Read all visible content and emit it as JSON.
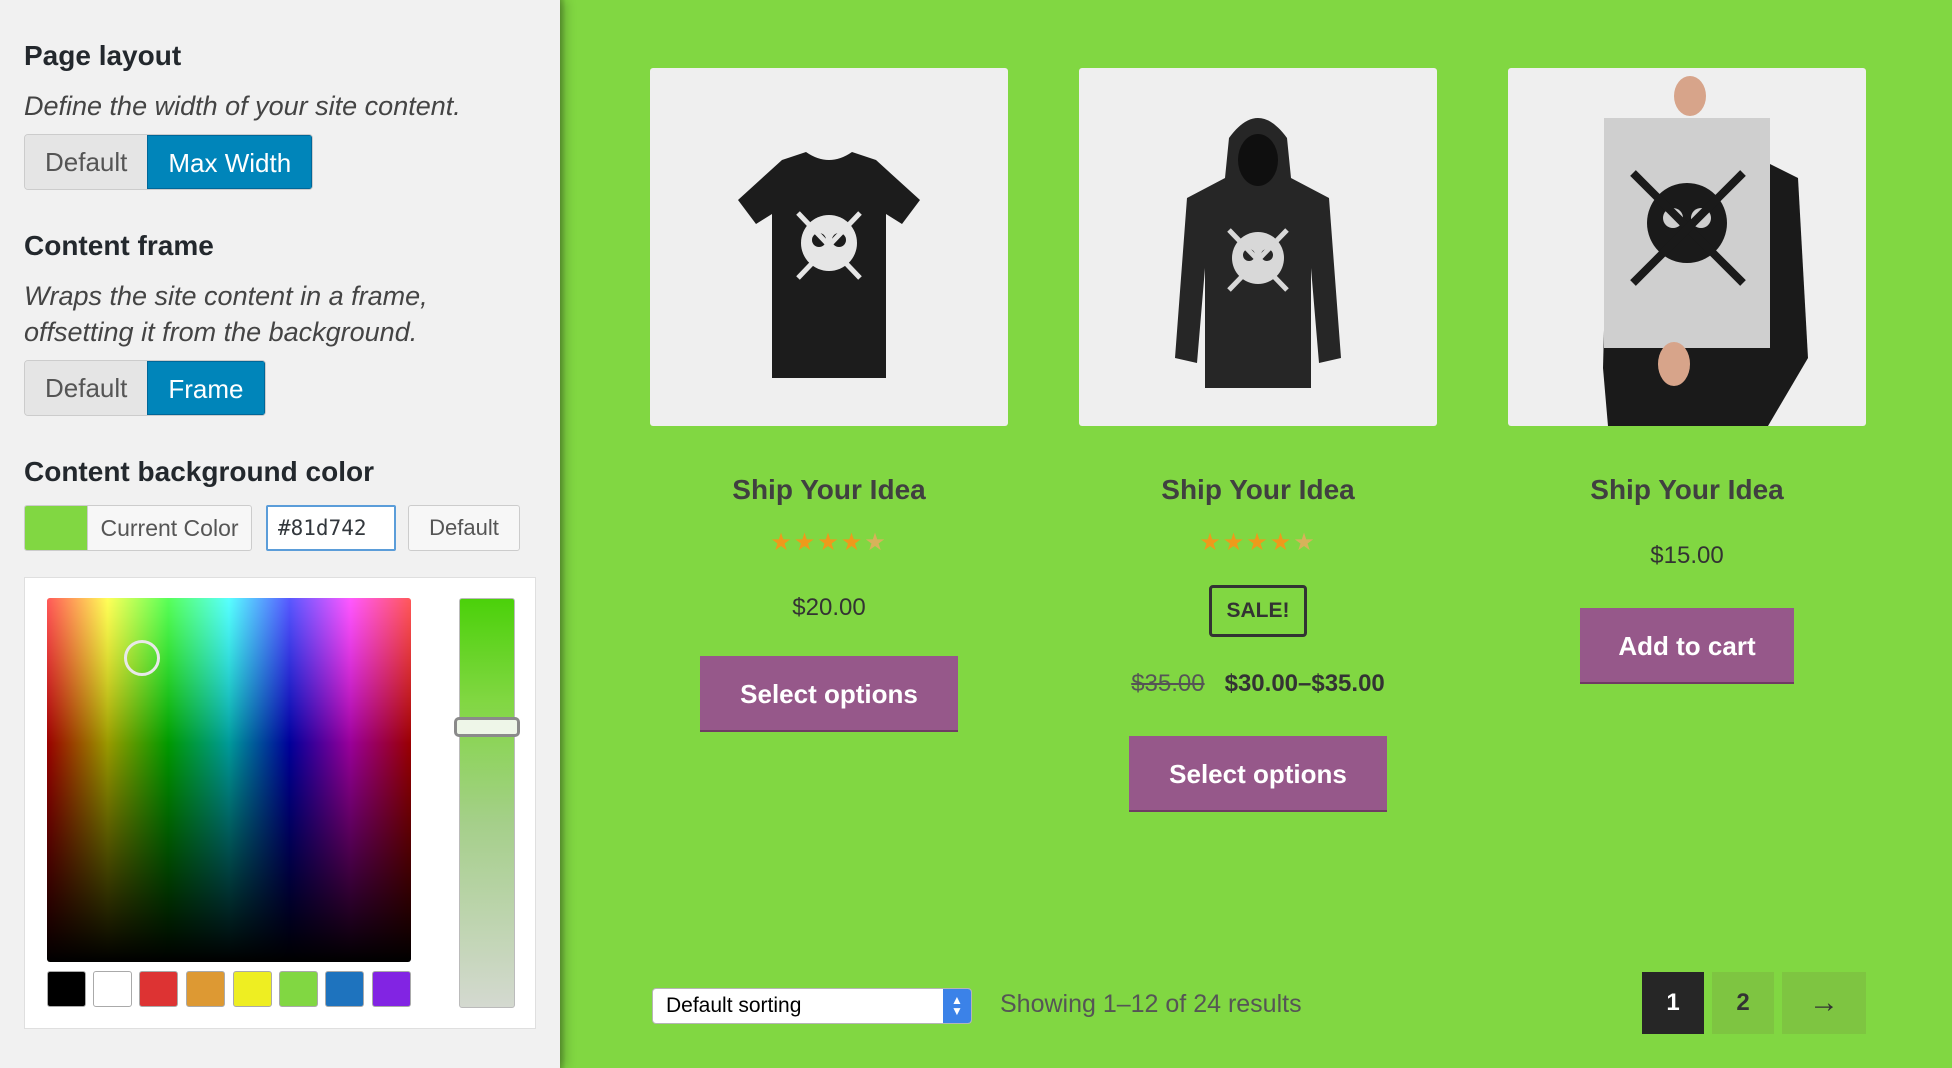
{
  "sidebar": {
    "page_layout": {
      "title": "Page layout",
      "description": "Define the width of your site content.",
      "options": [
        "Default",
        "Max Width"
      ],
      "selected": "Max Width"
    },
    "content_frame": {
      "title": "Content frame",
      "description_line1": "Wraps the site content in a frame,",
      "description_line2": "offsetting it from the background.",
      "options": [
        "Default",
        "Frame"
      ],
      "selected": "Frame"
    },
    "content_bg": {
      "title": "Content background color",
      "current_color_label": "Current Color",
      "hex_value": "#81d742",
      "default_label": "Default",
      "current_color": "#81d742",
      "palette": [
        "#000000",
        "#ffffff",
        "#dd3333",
        "#dd9933",
        "#eeee22",
        "#81d742",
        "#1e73be",
        "#8224e3"
      ]
    }
  },
  "products": [
    {
      "name": "Ship Your Idea",
      "image": "t-shirt",
      "rating": 4.5,
      "stars": "★★★★",
      "price": "$20.00",
      "button": "Select options"
    },
    {
      "name": "Ship Your Idea",
      "image": "hoodie",
      "rating": 4.5,
      "stars": "★★★★",
      "sale_badge": "SALE!",
      "old_price": "$35.00",
      "price": "$30.00–$35.00",
      "button": "Select options"
    },
    {
      "name": "Ship Your Idea",
      "image": "poster",
      "price": "$15.00",
      "button": "Add to cart"
    }
  ],
  "footer": {
    "sorting": "Default sorting",
    "results": "Showing 1–12 of 24 results",
    "pages": [
      "1",
      "2"
    ],
    "current_page": "1",
    "next_label": "→"
  },
  "colors": {
    "site_background": "#81d742",
    "button": "#96588a",
    "accent_blue": "#0085ba",
    "star": "#ee9a1b"
  }
}
